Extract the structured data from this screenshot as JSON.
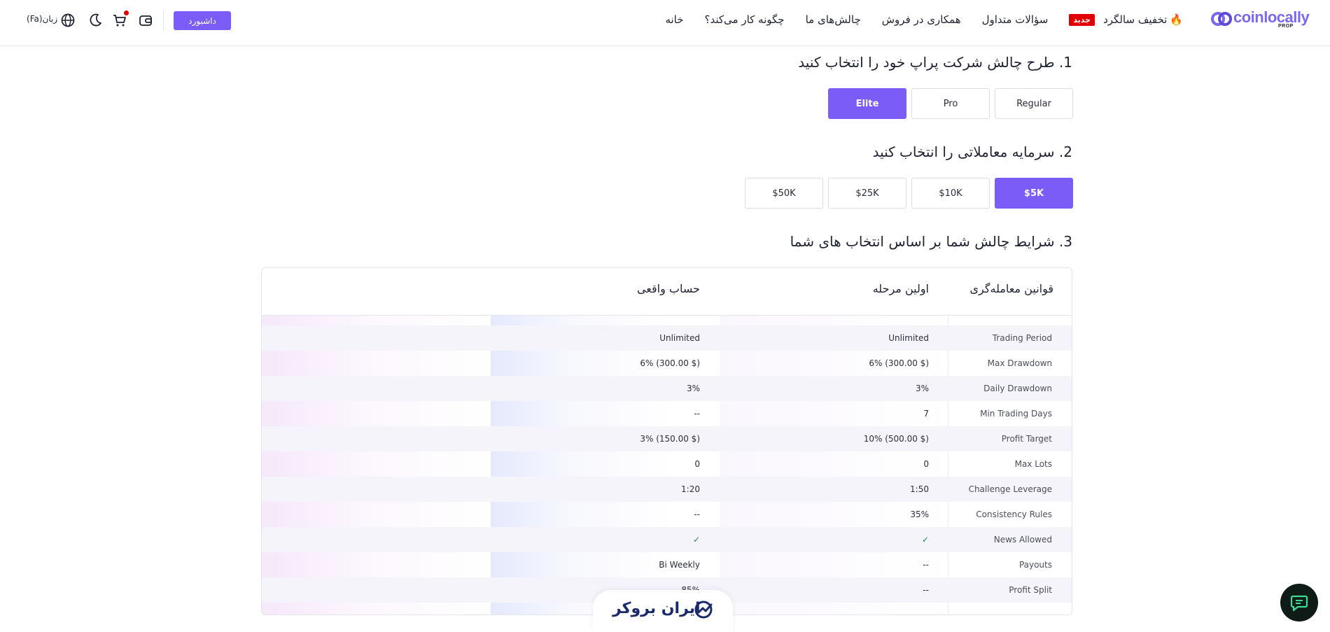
{
  "header": {
    "brand": {
      "name": "coinlocally",
      "sub": "PROP"
    },
    "nav": [
      {
        "label": "خانه"
      },
      {
        "label": "چگونه کار می‌کند؟"
      },
      {
        "label": "چالش‌های ما"
      },
      {
        "label": "همکاری در فروش"
      },
      {
        "label": "سؤالات متداول"
      },
      {
        "label": "تخفیف سالگرد"
      }
    ],
    "new_badge": "جدید",
    "dashboard_button": "داشبورد",
    "language": "زبان(Fa)",
    "icons": [
      "wallet-icon",
      "cart-icon",
      "moon-icon",
      "globe-icon",
      "fire-icon"
    ]
  },
  "step1": {
    "title": "1. طرح چالش شرکت پراپ خود را انتخاب کنید",
    "options": [
      "Regular",
      "Pro",
      "Elite"
    ],
    "selected": "Elite"
  },
  "step2": {
    "title": "2. سرمایه معاملاتی را انتخاب کنید",
    "options": [
      "$5K",
      "$10K",
      "$25K",
      "$50K"
    ],
    "selected": "$5K"
  },
  "step3": {
    "title": "3. شرایط چالش شما بر اساس انتخاب های شما"
  },
  "table": {
    "headers": [
      "قوانین معامله‌گری",
      "اولین مرحله",
      "حساب واقعی"
    ],
    "rows": [
      {
        "label": "Trading Period",
        "v1": "Unlimited",
        "v2": "Unlimited"
      },
      {
        "label": "Max Drawdown",
        "v1": "6% (300.00 $)",
        "v2": "6% (300.00 $)"
      },
      {
        "label": "Daily Drawdown",
        "v1": "3%",
        "v2": "3%"
      },
      {
        "label": "Min Trading Days",
        "v1": "7",
        "v2": "--"
      },
      {
        "label": "Profit Target",
        "v1": "10% (500.00 $)",
        "v2": "3% (150.00 $)"
      },
      {
        "label": "Max Lots",
        "v1": "0",
        "v2": "0"
      },
      {
        "label": "Challenge Leverage",
        "v1": "1:50",
        "v2": "1:20"
      },
      {
        "label": "Consistency Rules",
        "v1": "35%",
        "v2": "--"
      },
      {
        "label": "News Allowed",
        "v1": "✓",
        "v2": "✓"
      },
      {
        "label": "Payouts",
        "v1": "--",
        "v2": "Bi Weekly"
      },
      {
        "label": "Profit Split",
        "v1": "--",
        "v2": "85%"
      }
    ]
  },
  "watermark": {
    "text": "ایران بروکر"
  },
  "colors": {
    "accent": "#7b5cf6",
    "brand": "#7b68ee",
    "badge": "#e00000",
    "check": "#1a8a4a"
  }
}
